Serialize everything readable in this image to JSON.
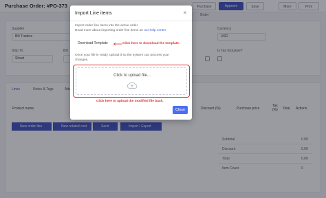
{
  "header": {
    "title": "Purchase Order: #PO-373",
    "buttons": [
      "Purchase Order",
      "Approve",
      "Save",
      "More",
      "Print"
    ]
  },
  "form": {
    "supplier_label": "Supplier",
    "supplier_value": "Bill Traders",
    "currency_label": "Currency",
    "currency_value": "USD",
    "ship_to_label": "Ship To",
    "ship_to_value": "Sheet",
    "bill_label": "Bill",
    "tax_label": "Is Tax Inclusive?"
  },
  "tabs": [
    "Lines",
    "Notes & Tags",
    "Attachments"
  ],
  "table": {
    "headers": [
      "Product name",
      "Discount (%)",
      "Purchase price",
      "Tax (%)",
      "Total",
      "Actions"
    ]
  },
  "actions": [
    "New order line",
    "New related cost",
    "Send Items",
    "Import / Export"
  ],
  "summary": {
    "rows": [
      {
        "label": "Subtotal",
        "value": "0.00"
      },
      {
        "label": "Discount",
        "value": "0.00"
      },
      {
        "label": "Total",
        "value": "0.00"
      },
      {
        "label": "Item Count",
        "value": "0"
      }
    ]
  },
  "modal": {
    "title": "Import Line items",
    "close_icon": "×",
    "intro_line1": "Import order line items into the active order.",
    "intro_line2_prefix": "Read more about importing order line items on",
    "intro_line2_link": "our help center",
    "download_button": "Download Template",
    "download_note": "Click here to download the template.",
    "ready_line1": "Once your file is ready, upload it so the system can process your",
    "ready_line2": "changes.",
    "upload_label": "Click to upload file...",
    "upload_note": "Click here to upload the modified file back.",
    "close_button": "Close",
    "colors": {
      "accent": "#4c6ef5",
      "annotation": "#e03131"
    }
  }
}
